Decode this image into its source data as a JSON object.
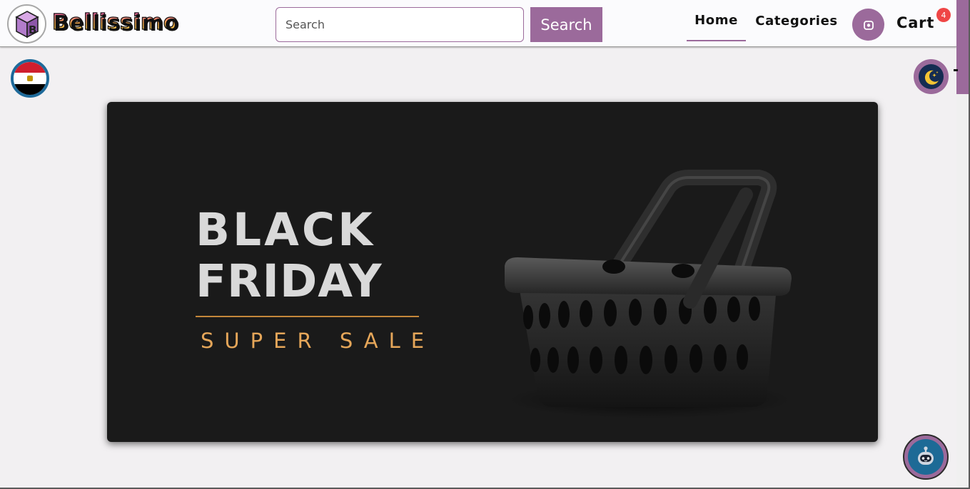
{
  "brand": {
    "name": "Bellissimo",
    "logo_icon": "cube-b-icon"
  },
  "search": {
    "placeholder": "Search",
    "value": "",
    "button_label": "Search"
  },
  "nav": {
    "items": [
      {
        "label": "Home",
        "active": true
      },
      {
        "label": "Categories",
        "active": false
      }
    ],
    "user_icon": "user-icon",
    "cart_label": "Cart",
    "cart_count": "4"
  },
  "controls": {
    "language_flag": "egypt-flag-icon",
    "theme_icon": "moon-stars-icon",
    "chat_icon": "robot-chat-icon"
  },
  "banner": {
    "line1": "BLACK",
    "line2": "FRIDAY",
    "subtitle": "SUPER SALE",
    "image": "shopping-basket-image"
  },
  "colors": {
    "accent": "#9b6a9b",
    "badge": "#ef4646",
    "banner_bg": "#1a1a1a",
    "gold": "#e5a659",
    "page_bg": "#f2f0f2"
  }
}
